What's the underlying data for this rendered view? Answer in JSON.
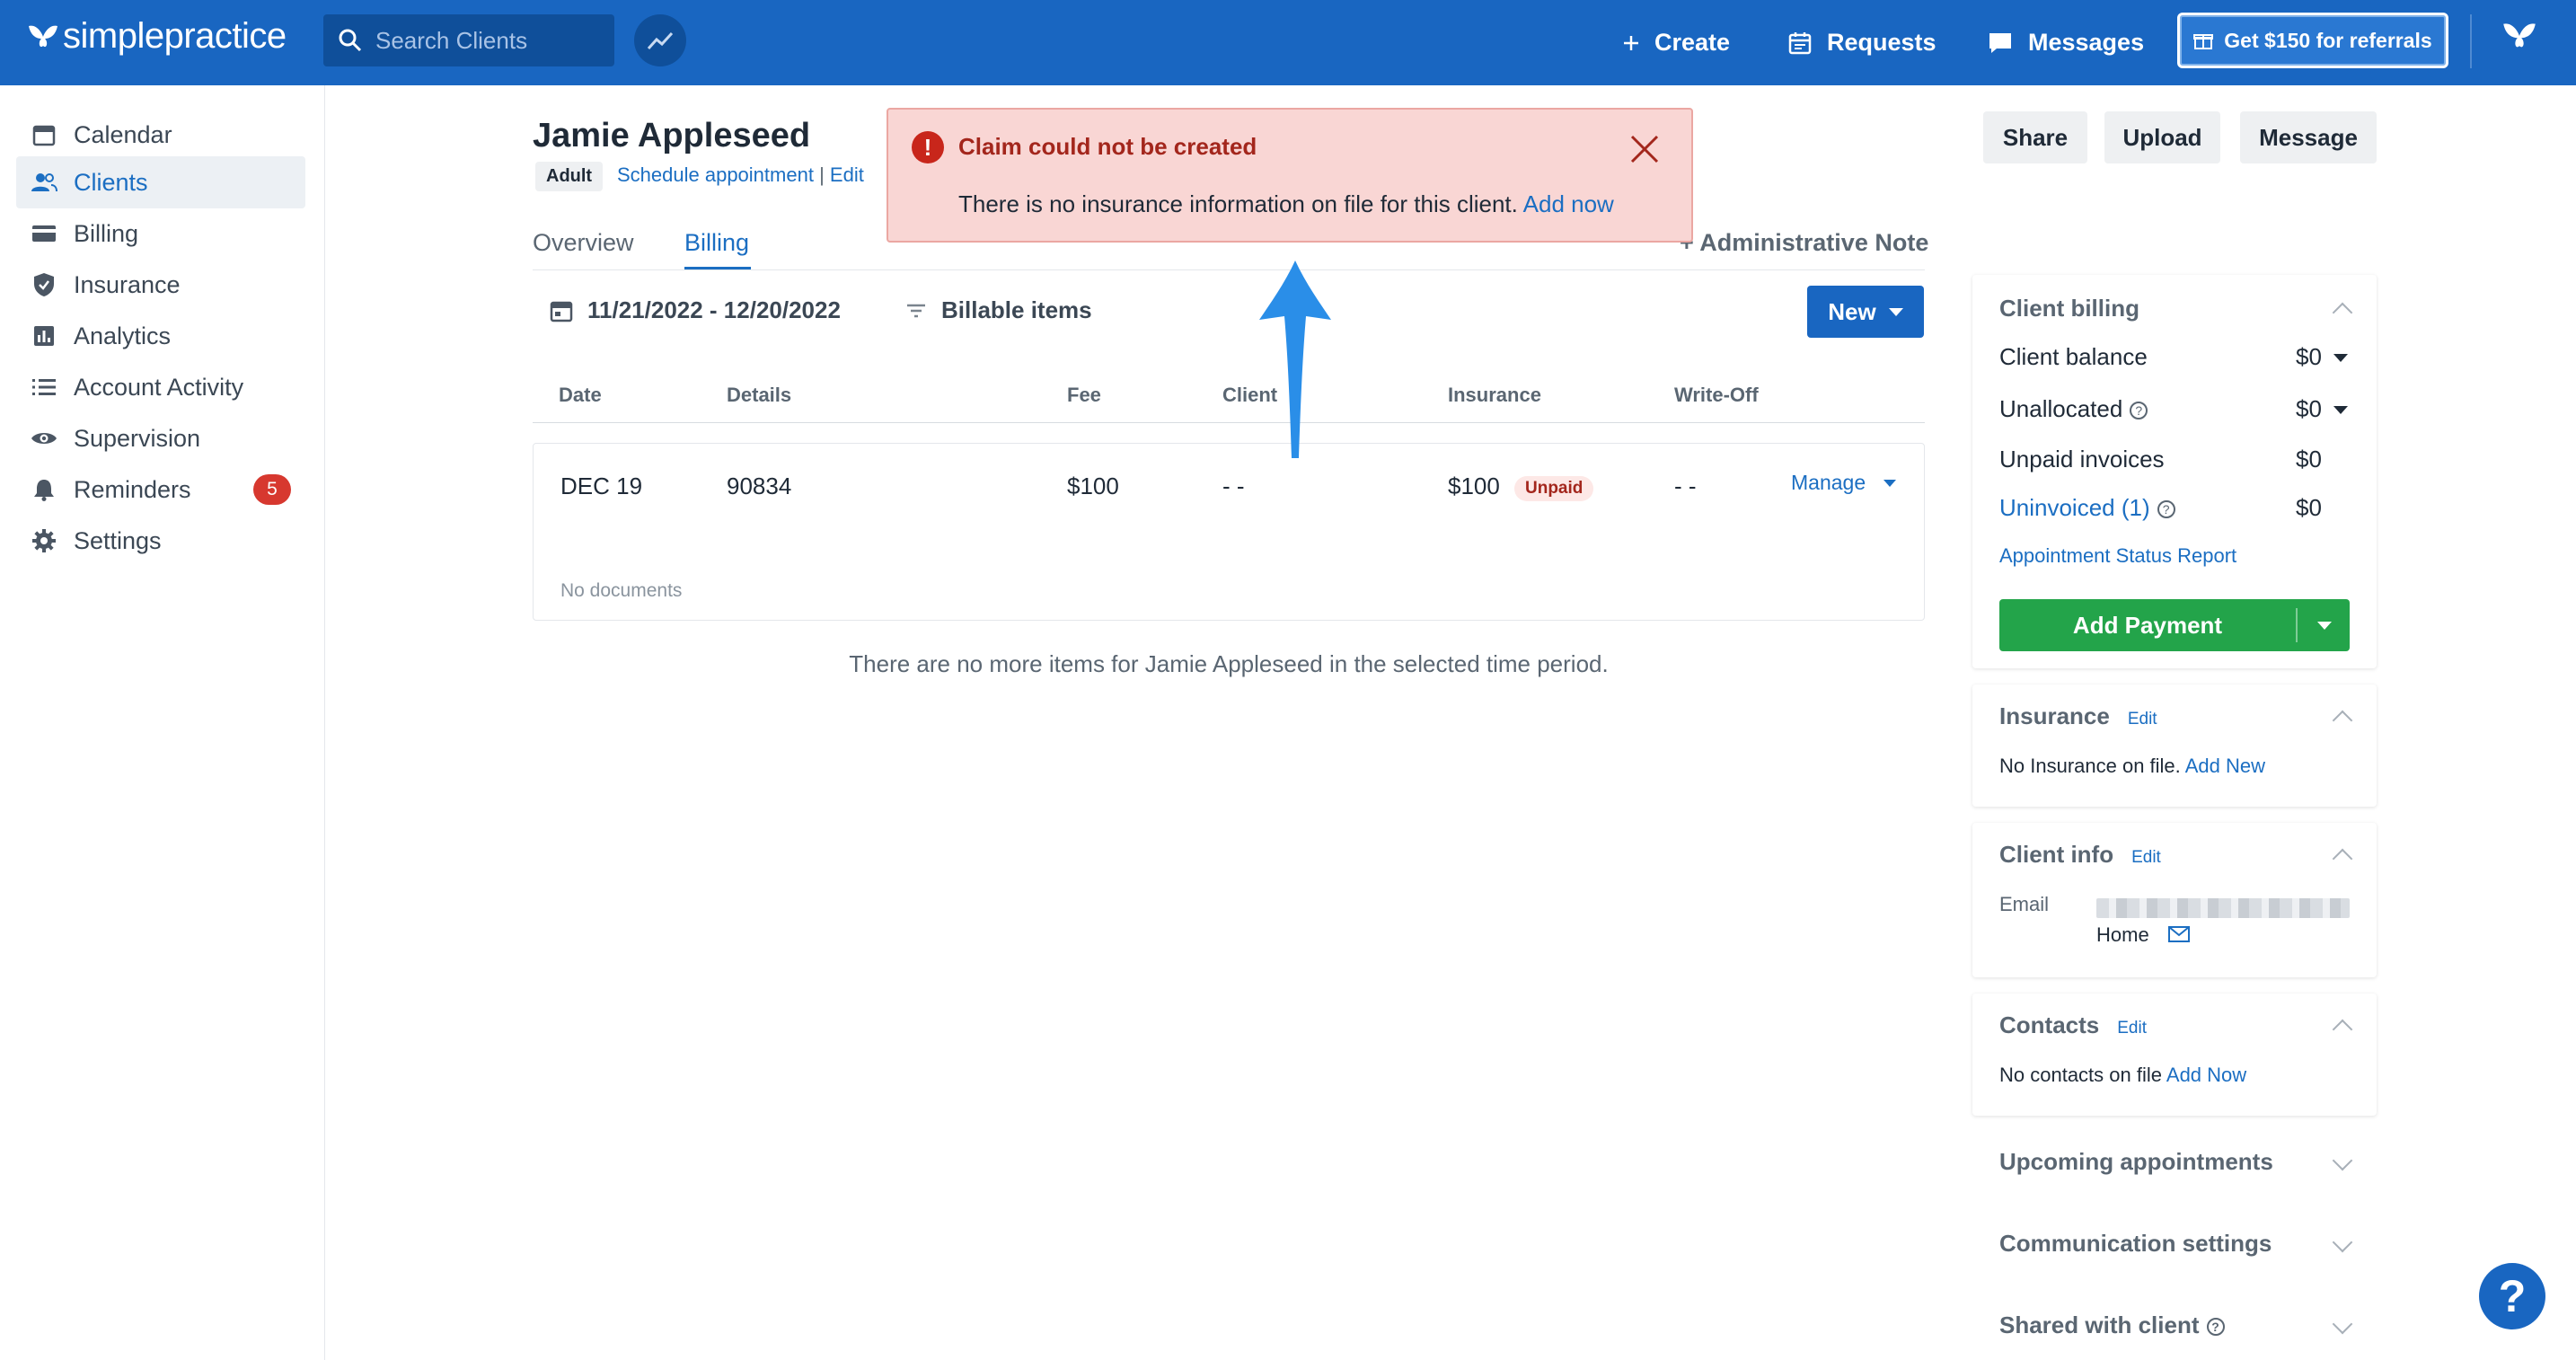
{
  "header": {
    "logo_text": "simplepractice",
    "search_placeholder": "Search Clients",
    "create_label": "Create",
    "requests_label": "Requests",
    "messages_label": "Messages",
    "referral_label": "Get $150 for referrals"
  },
  "sidebar": {
    "items": [
      {
        "label": "Calendar",
        "icon": "calendar-icon"
      },
      {
        "label": "Clients",
        "icon": "clients-icon",
        "active": true
      },
      {
        "label": "Billing",
        "icon": "card-icon"
      },
      {
        "label": "Insurance",
        "icon": "shield-icon"
      },
      {
        "label": "Analytics",
        "icon": "bar-chart-icon"
      },
      {
        "label": "Account Activity",
        "icon": "list-icon"
      },
      {
        "label": "Supervision",
        "icon": "eye-icon"
      },
      {
        "label": "Reminders",
        "icon": "bell-icon",
        "badge": "5"
      },
      {
        "label": "Settings",
        "icon": "gear-icon"
      }
    ]
  },
  "client": {
    "name": "Jamie Appleseed",
    "type_badge": "Adult",
    "schedule_link": "Schedule appointment",
    "separator": "|",
    "edit_link": "Edit"
  },
  "tabs": {
    "overview": "Overview",
    "billing": "Billing",
    "admin_note": "Administrative Note"
  },
  "toolbar": {
    "date_range": "11/21/2022 - 12/20/2022",
    "filter_label": "Billable items",
    "new_label": "New"
  },
  "table": {
    "headers": [
      "Date",
      "Details",
      "Fee",
      "Client",
      "Insurance",
      "Write-Off"
    ],
    "row": {
      "date": "DEC 19",
      "details": "90834",
      "fee": "$100",
      "client": "- -",
      "insurance": "$100",
      "status": "Unpaid",
      "write_off": "- -",
      "manage": "Manage"
    },
    "no_documents": "No documents",
    "no_more_items": "There are no more items for Jamie Appleseed in the selected time period."
  },
  "alert": {
    "title": "Claim could not be created",
    "message": "There is no insurance information on file for this client.",
    "action": "Add now"
  },
  "actions": {
    "share": "Share",
    "upload": "Upload",
    "message": "Message"
  },
  "client_billing": {
    "title": "Client billing",
    "client_balance_label": "Client balance",
    "client_balance_value": "$0",
    "unallocated_label": "Unallocated",
    "unallocated_value": "$0",
    "unpaid_invoices_label": "Unpaid invoices",
    "unpaid_invoices_value": "$0",
    "uninvoiced_label": "Uninvoiced (1)",
    "uninvoiced_value": "$0",
    "status_report_link": "Appointment Status Report",
    "add_payment_label": "Add Payment"
  },
  "insurance_panel": {
    "title": "Insurance",
    "edit": "Edit",
    "text": "No Insurance on file.",
    "add_link": "Add New"
  },
  "client_info": {
    "title": "Client info",
    "edit": "Edit",
    "email_label": "Email",
    "email_type": "Home"
  },
  "contacts": {
    "title": "Contacts",
    "edit": "Edit",
    "text": "No contacts on file",
    "add_link": "Add Now"
  },
  "collapsed_sections": {
    "upcoming": "Upcoming appointments",
    "communication": "Communication settings",
    "shared": "Shared with client"
  },
  "help_label": "?",
  "colors": {
    "brand_blue": "#1966c1",
    "alert_bg": "#f9d6d4",
    "alert_text": "#a3261c",
    "payment_green": "#23a44a"
  }
}
